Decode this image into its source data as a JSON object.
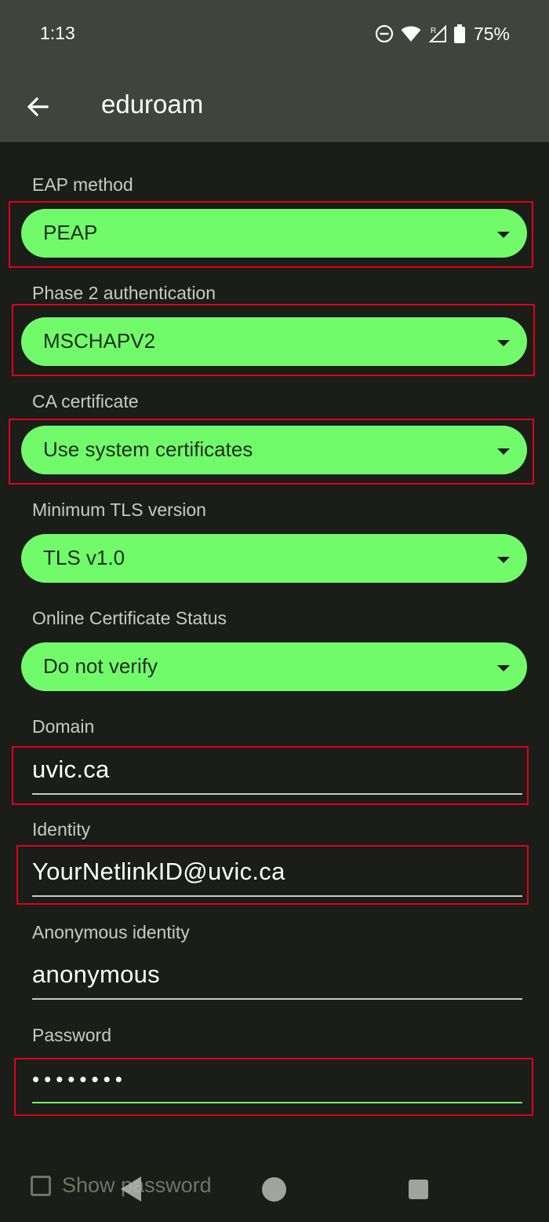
{
  "status": {
    "time": "1:13",
    "battery": "75%"
  },
  "appbar": {
    "title": "eduroam"
  },
  "form": {
    "eap_label": "EAP method",
    "eap_value": "PEAP",
    "phase2_label": "Phase 2 authentication",
    "phase2_value": "MSCHAPV2",
    "ca_label": "CA certificate",
    "ca_value": "Use system certificates",
    "tls_label": "Minimum TLS version",
    "tls_value": "TLS v1.0",
    "ocsp_label": "Online Certificate Status",
    "ocsp_value": "Do not verify",
    "domain_label": "Domain",
    "domain_value": "uvic.ca",
    "identity_label": "Identity",
    "identity_value": "YourNetlinkID@uvic.ca",
    "anon_label": "Anonymous identity",
    "anon_value": "anonymous",
    "password_label": "Password",
    "password_value": "••••••••",
    "show_password": "Show password"
  },
  "icons": {
    "back": "arrow-left-icon",
    "dnd": "do-not-disturb-icon",
    "wifi": "wifi-icon",
    "signal": "signal-icon",
    "battery": "battery-icon"
  },
  "colors": {
    "accent": "#71fb6b",
    "highlight": "#e0001b",
    "background": "#1a1d18",
    "appbar": "#3f443c"
  }
}
